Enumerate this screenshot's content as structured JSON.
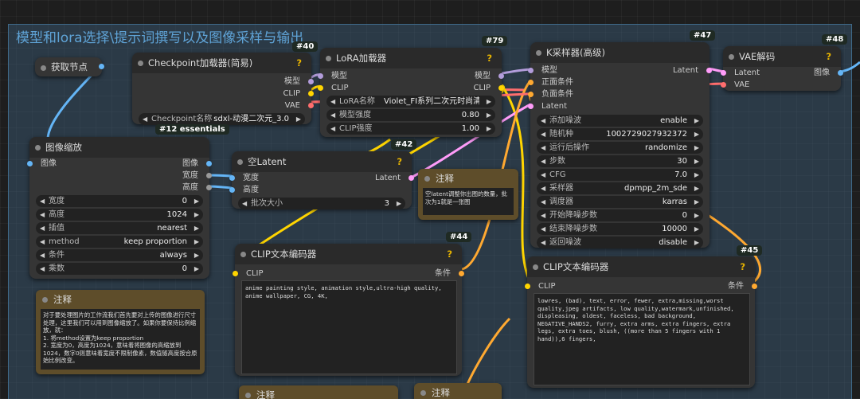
{
  "group_title": "模型和lora选择\\提示词撰写以及图像采样与输出",
  "badges": {
    "n40": "#40",
    "n79": "#79",
    "n47": "#47",
    "n48": "#48",
    "n12": "#12 essentials",
    "n42": "#42",
    "n44": "#44",
    "n45": "#45"
  },
  "get_node": {
    "title": "获取节点"
  },
  "checkpoint": {
    "title": "Checkpoint加载器(简易)",
    "out_model": "模型",
    "out_clip": "CLIP",
    "out_vae": "VAE",
    "w_label": "Checkpoint名称",
    "w_value": "sdxl-动漫二次元_3.0"
  },
  "lora": {
    "title": "LoRA加载器",
    "in_model": "模型",
    "in_clip": "CLIP",
    "out_model": "模型",
    "out_clip": "CLIP",
    "w1_label": "LoRA名称",
    "w1_value": "Violet_FI系列二次元时尚清新...",
    "w2_label": "模型强度",
    "w2_value": "0.80",
    "w3_label": "CLIP强度",
    "w3_value": "1.00"
  },
  "ksampler": {
    "title": "K采样器(高级)",
    "in_model": "模型",
    "in_pos": "正面条件",
    "in_neg": "负面条件",
    "in_latent": "Latent",
    "out_latent": "Latent",
    "widgets": [
      {
        "label": "添加噪波",
        "value": "enable"
      },
      {
        "label": "随机种",
        "value": "1002729027932372"
      },
      {
        "label": "运行后操作",
        "value": "randomize"
      },
      {
        "label": "步数",
        "value": "30"
      },
      {
        "label": "CFG",
        "value": "7.0"
      },
      {
        "label": "采样器",
        "value": "dpmpp_2m_sde"
      },
      {
        "label": "调度器",
        "value": "karras"
      },
      {
        "label": "开始降噪步数",
        "value": "0"
      },
      {
        "label": "结束降噪步数",
        "value": "10000"
      },
      {
        "label": "返回噪波",
        "value": "disable"
      }
    ]
  },
  "vae": {
    "title": "VAE解码",
    "in_latent": "Latent",
    "in_vae": "VAE",
    "out_image": "图像"
  },
  "resize": {
    "title": "图像缩放",
    "in_image": "图像",
    "out_image": "图像",
    "out_width": "宽度",
    "out_height": "高度",
    "widgets": [
      {
        "label": "宽度",
        "value": "0"
      },
      {
        "label": "高度",
        "value": "1024"
      },
      {
        "label": "插值",
        "value": "nearest"
      },
      {
        "label": "method",
        "value": "keep proportion"
      },
      {
        "label": "条件",
        "value": "always"
      },
      {
        "label": "乘数",
        "value": "0"
      }
    ]
  },
  "latent": {
    "title": "空Latent",
    "in_width": "宽度",
    "in_height": "高度",
    "out_latent": "Latent",
    "w_label": "批次大小",
    "w_value": "3"
  },
  "note_small": {
    "title": "注释",
    "text": "空latent调整你出图的数量，批次为1就是一张图"
  },
  "note_left": {
    "title": "注释",
    "text": "对于要处理图片的工作流我们首先要对上传的图像进行尺寸处理，这里我们可以用到图像缩放了。如果你要保持比例缩放，就：\n1. 将method设置为keep proportion\n2. 宽度为0，高度为1024，意味着将图像的高缩放到1024，数字0则意味着宽度不限制像素，数值随高度按合原始比例改变。"
  },
  "note_bottom": {
    "title": "注释"
  },
  "note_bottom2": {
    "title": "注释"
  },
  "clip44": {
    "title": "CLIP文本编码器",
    "in_clip": "CLIP",
    "out_cond": "条件",
    "text": "anime painting style, animation style,ultra-high quality, anime wallpaper, CG, 4K,"
  },
  "clip45": {
    "title": "CLIP文本编码器",
    "in_clip": "CLIP",
    "out_cond": "条件",
    "text": "lowres, (bad), text, error, fewer, extra,missing,worst quality,jpeg artifacts, low quality,watermark,unfinished, displeasing, oldest, faceless, bad background, NEGATIVE_HANDS2, furry, extra arms, extra fingers, extra legs, extra toes, blush, ((more than 5 fingers with 1 hand)),6 fingers,"
  }
}
